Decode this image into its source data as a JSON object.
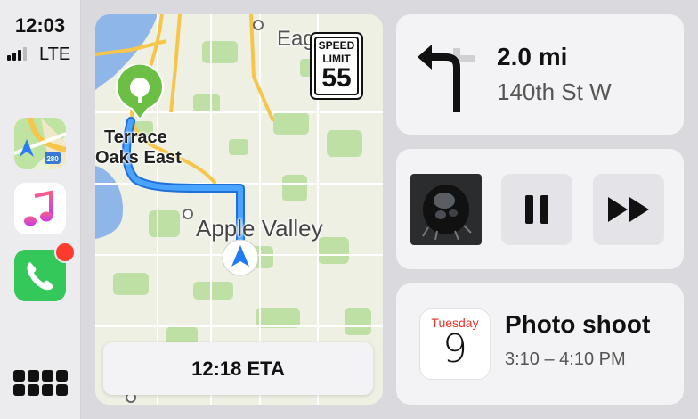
{
  "status": {
    "time": "12:03",
    "network": "LTE"
  },
  "dock": {
    "apps": [
      {
        "name": "Maps",
        "icon": "maps-app-icon"
      },
      {
        "name": "Music",
        "icon": "music-app-icon"
      },
      {
        "name": "Phone",
        "icon": "phone-app-icon",
        "badge": true
      }
    ],
    "app_grid_icon": "app-grid-icon"
  },
  "map": {
    "labels": {
      "eagan": "Eag",
      "terrace_line1": "Terrace",
      "terrace_line2": "Oaks East",
      "apple_valley": "Apple Valley"
    },
    "speed_limit": {
      "line1": "SPEED",
      "line2": "LIMIT",
      "value": "55"
    },
    "eta": "12:18 ETA",
    "destination_icon": "tree-icon",
    "current_location_icon": "navigation-arrow-icon"
  },
  "navigation": {
    "distance": "2.0 mi",
    "street": "140th St W",
    "maneuver_icon": "turn-left-icon"
  },
  "now_playing": {
    "artwork_icon": "album-artwork",
    "pause_icon": "pause-icon",
    "next_icon": "fast-forward-icon"
  },
  "calendar": {
    "weekday": "Tuesday",
    "date": "9",
    "title": "Photo shoot",
    "time": "3:10 – 4:10 PM"
  },
  "colors": {
    "route": "#2f8fff",
    "badge": "#ff3b30",
    "phone": "#34c759",
    "calendar_red": "#e0342b",
    "destination_pin": "#6cbf45"
  }
}
